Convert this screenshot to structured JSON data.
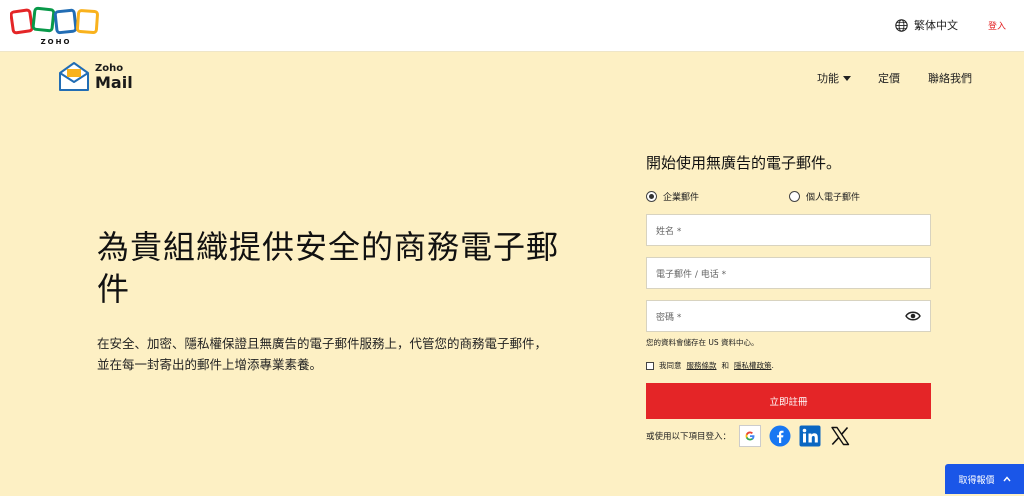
{
  "header": {
    "language_label": "繁体中文",
    "login_label": "登入"
  },
  "nav": {
    "brand_small": "Zoho",
    "brand_large": "Mail",
    "features_label": "功能",
    "pricing_label": "定價",
    "contact_label": "聯絡我們"
  },
  "hero": {
    "title": "為貴組織提供安全的商務電子郵件",
    "description": "在安全、加密、隱私權保證且無廣告的電子郵件服務上，代管您的商務電子郵件，並在每一封寄出的郵件上增添專業素養。"
  },
  "signup": {
    "title": "開始使用無廣告的電子郵件。",
    "radio_business": "企業郵件",
    "radio_personal": "個人電子郵件",
    "name_placeholder": "姓名 *",
    "email_placeholder": "電子郵件  / 电话 *",
    "password_placeholder": "密碼 *",
    "storage_note": "您的資料會儲存在 US 資料中心。",
    "agree_prefix": "我同意",
    "terms_link": "服務條款",
    "agree_and": "和",
    "privacy_link": "隱私權政策",
    "agree_suffix": ".",
    "submit_label": "立即註冊",
    "social_label": "或使用以下項目登入："
  },
  "quote": {
    "label": "取得報價"
  },
  "colors": {
    "background": "#fdf0c4",
    "accent_red": "#e42527",
    "accent_blue": "#1a56e8"
  },
  "icons": [
    "zoho-logo",
    "globe-icon",
    "mail-envelope-logo",
    "chevron-down-icon",
    "eye-icon",
    "google-icon",
    "facebook-icon",
    "linkedin-icon",
    "x-icon",
    "chevron-up-icon"
  ]
}
